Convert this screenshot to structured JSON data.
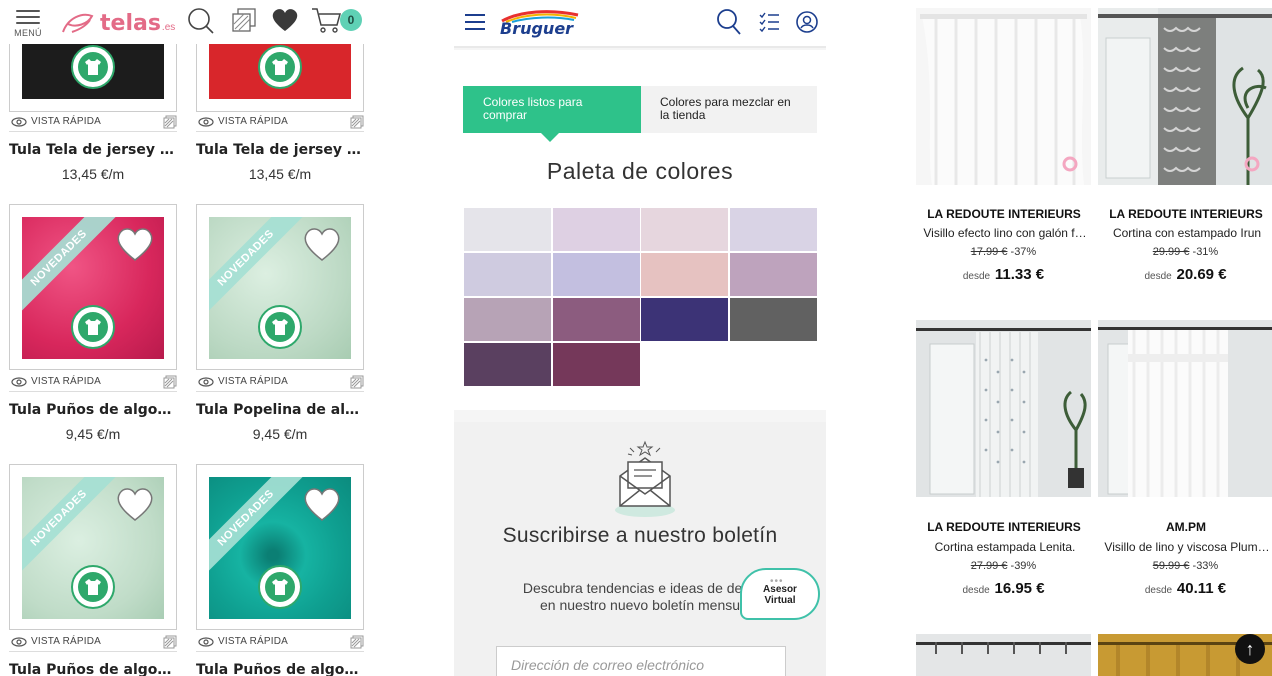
{
  "telas": {
    "menu_label": "MENÚ",
    "logo_text": "telas",
    "logo_tld": ".es",
    "cart_count": "0",
    "quick_view": "VISTA RÁPIDA",
    "ribbon": "NOVEDADES",
    "products": [
      {
        "title": "Tula Tela de jersey de …",
        "price": "13,45 €/m",
        "color": "#1c1c1c"
      },
      {
        "title": "Tula Tela de jersey de …",
        "price": "13,45 €/m",
        "color": "#d8262b"
      },
      {
        "title": "Tula Puños de algodó…",
        "price": "9,45 €/m",
        "color": "#e03569"
      },
      {
        "title": "Tula Popelina de algo…",
        "price": "9,45 €/m",
        "color": "#c7e1cd"
      },
      {
        "title": "Tula Puños de algodó…",
        "price": "",
        "color": "#c6e3cf"
      },
      {
        "title": "Tula Puños de algodó…",
        "price": "",
        "color": "#0ea596"
      }
    ]
  },
  "bruguer": {
    "logo_text": "Bruguer",
    "tab_ready": "Colores listos para comprar",
    "tab_mix": "Colores para mezclar en la tienda",
    "palette_title": "Paleta de colores",
    "swatches": [
      "#e5e4ea",
      "#ded0e3",
      "#e6d6de",
      "#d9d3e5",
      "#cfcbe0",
      "#c3bfe0",
      "#e6c2c1",
      "#bea3bd",
      "#b7a3b6",
      "#8c5c7f",
      "#3c3376",
      "#616161",
      "#5a4060",
      "#75385a"
    ],
    "newsletter_title": "Suscribirse a nuestro boletín",
    "newsletter_text": "Descubra tendencias e ideas de decoración en nuestro nuevo boletín mensual",
    "newsletter_text_visible_a": "Descubra tendencias e ideas de deco",
    "newsletter_text_visible_b": "en nuestro nuevo boletín mensu",
    "email_placeholder": "Dirección de correo electrónico",
    "advisor_dots": "•••",
    "advisor_line1": "Asesor",
    "advisor_line2": "Virtual"
  },
  "redoute": {
    "from_label": "desde",
    "products": [
      {
        "brand": "LA REDOUTE INTERIEURS",
        "name": "Visillo efecto lino con galón f…",
        "old_price": "17.99 €",
        "discount": "-37%",
        "price": "11.33 €"
      },
      {
        "brand": "LA REDOUTE INTERIEURS",
        "name": "Cortina con estampado Irun",
        "old_price": "29.99 €",
        "discount": "-31%",
        "price": "20.69 €"
      },
      {
        "brand": "LA REDOUTE INTERIEURS",
        "name": "Cortina estampada Lenita.",
        "old_price": "27.99 €",
        "discount": "-39%",
        "price": "16.95 €"
      },
      {
        "brand": "AM.PM",
        "name": "Visillo de lino y viscosa Plum…",
        "old_price": "59.99 €",
        "discount": "-33%",
        "price": "40.11 €"
      }
    ],
    "back_to_top": "↑"
  }
}
